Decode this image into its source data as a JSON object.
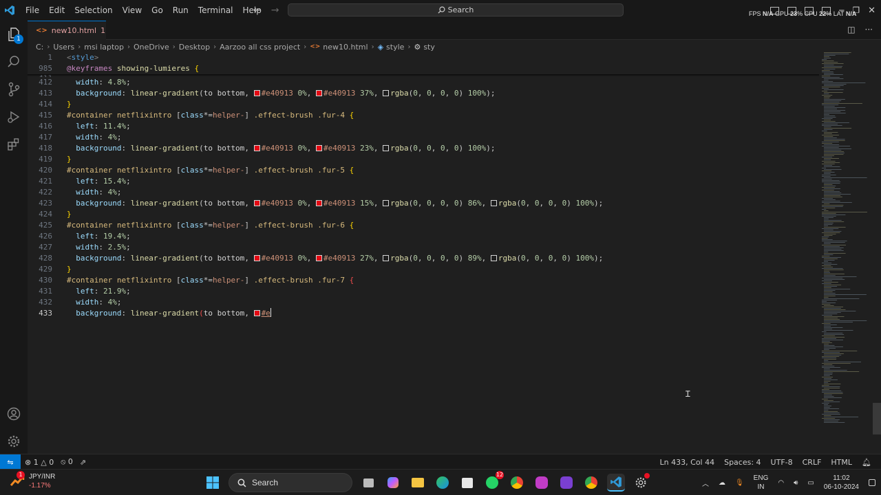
{
  "titlebar": {
    "menu": [
      "File",
      "Edit",
      "Selection",
      "View",
      "Go",
      "Run",
      "Terminal",
      "Help"
    ],
    "search_label": "Search",
    "perf": {
      "fps_label": "FPS",
      "fps": "N/A",
      "gpu_label": "GPU",
      "gpu": "23",
      "gpu_unit": "%",
      "cpu_label": "CPU",
      "cpu": "22",
      "cpu_unit": "%",
      "lat_label": "LAT",
      "lat": "N/A"
    }
  },
  "tab": {
    "filename": "new10.html",
    "problems": "1"
  },
  "breadcrumb": [
    "C:",
    "Users",
    "msi laptop",
    "OneDrive",
    "Desktop",
    "Aarzoo all css project",
    "new10.html",
    "style",
    "sty"
  ],
  "activity_badge": "1",
  "statusbar": {
    "errors": "1",
    "warnings": "0",
    "ports": "0",
    "position": "Ln 433, Col 44",
    "spaces": "Spaces: 4",
    "encoding": "UTF-8",
    "eol": "CRLF",
    "language": "HTML"
  },
  "taskbar": {
    "ticker": "JPY/INR",
    "ticker_change": "-1.17%",
    "ticker_badge": "1",
    "search": "Search",
    "whatsapp_badge": "12",
    "lang1": "ENG",
    "lang2": "IN",
    "time": "11:02",
    "date": "06-10-2024"
  },
  "colors": {
    "accent": "#0078d4",
    "swatch": "#e40913"
  }
}
